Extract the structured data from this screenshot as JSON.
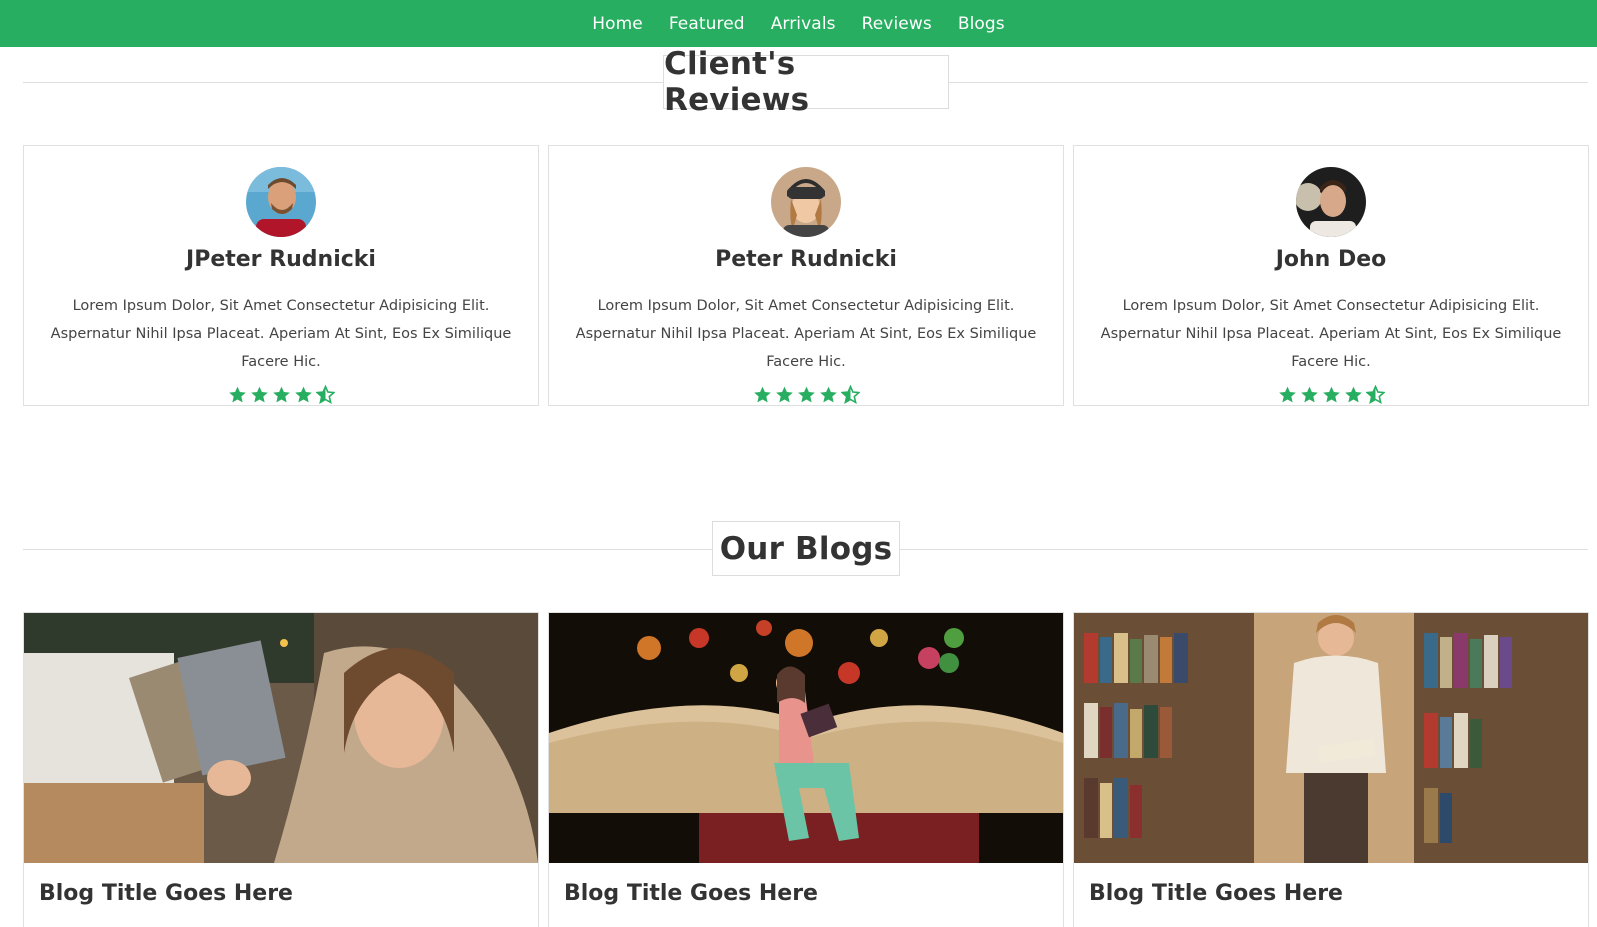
{
  "nav": {
    "items": [
      "Home",
      "Featured",
      "Arrivals",
      "Reviews",
      "Blogs"
    ]
  },
  "reviews_section": {
    "title": "Client's Reviews",
    "reviews": [
      {
        "name": "JPeter Rudnicki",
        "text": "Lorem Ipsum Dolor, Sit Amet Consectetur Adipisicing Elit. Aspernatur Nihil Ipsa Placeat. Aperiam At Sint, Eos Ex Similique Facere Hic.",
        "rating": 4.5,
        "avatar_icon": "man-photo"
      },
      {
        "name": "Peter Rudnicki",
        "text": "Lorem Ipsum Dolor, Sit Amet Consectetur Adipisicing Elit. Aspernatur Nihil Ipsa Placeat. Aperiam At Sint, Eos Ex Similique Facere Hic.",
        "rating": 4.5,
        "avatar_icon": "woman-photo"
      },
      {
        "name": "John Deo",
        "text": "Lorem Ipsum Dolor, Sit Amet Consectetur Adipisicing Elit. Aspernatur Nihil Ipsa Placeat. Aperiam At Sint, Eos Ex Similique Facere Hic.",
        "rating": 4.5,
        "avatar_icon": "man-photo"
      }
    ]
  },
  "blogs_section": {
    "title": "Our Blogs",
    "blogs": [
      {
        "title": "Blog Title Goes Here",
        "image_icon": "woman-holding-books-photo"
      },
      {
        "title": "Blog Title Goes Here",
        "image_icon": "reading-figure-on-book-photo"
      },
      {
        "title": "Blog Title Goes Here",
        "image_icon": "library-shelves-photo"
      }
    ]
  },
  "colors": {
    "brand": "#27ae60",
    "star": "#27ae60",
    "text": "#333333"
  }
}
